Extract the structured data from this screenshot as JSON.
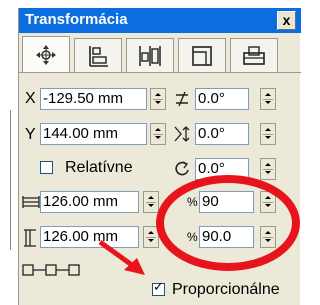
{
  "panel": {
    "title": "Transformácia",
    "close_label": "x"
  },
  "tabs": [
    {
      "icon": "move-icon"
    },
    {
      "icon": "align-icon"
    },
    {
      "icon": "distribute-icon"
    },
    {
      "icon": "size-icon"
    },
    {
      "icon": "scale-icon"
    }
  ],
  "position": {
    "x_label": "X",
    "x_value": "-129.50 mm",
    "y_label": "Y",
    "y_value": "144.00 mm",
    "relative_label": "Relatívne",
    "relative_checked": false
  },
  "rotation": {
    "angle_value": "0.0°",
    "skew_value": "0.0°",
    "rotate_value": "0.0°"
  },
  "size": {
    "width_value": "126.00 mm",
    "height_value": "126.00 mm",
    "width_percent": "90",
    "height_percent": "90.0",
    "percent_symbol": "%",
    "proportional_label": "Proporcionálne",
    "proportional_checked": true
  },
  "annotations": {
    "circle_color": "#e8141b",
    "arrow_color": "#e8141b"
  }
}
